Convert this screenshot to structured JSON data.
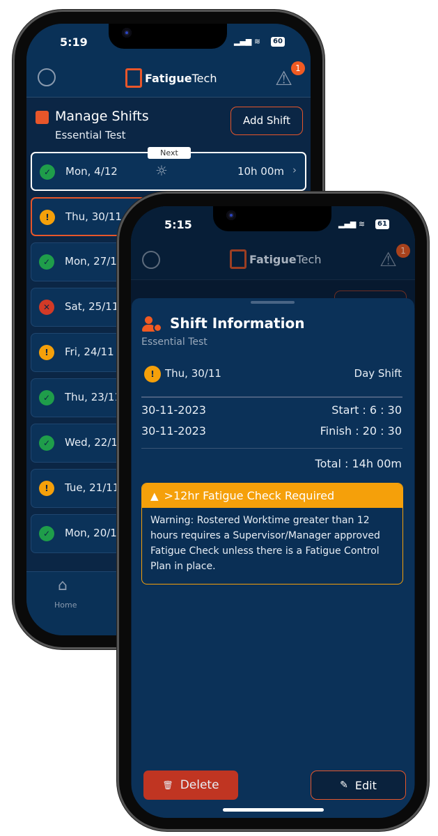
{
  "phone_back": {
    "status": {
      "time": "5:19",
      "battery": "60"
    },
    "header": {
      "logo": "FatigueTech",
      "logo_a": "Fatigue",
      "logo_b": "Tech",
      "alerts_badge": "1"
    },
    "section": {
      "title": "Manage Shifts",
      "subtitle": "Essential Test",
      "add_button": "Add Shift"
    },
    "next_label": "Next",
    "shifts": [
      {
        "date": "Mon, 4/12",
        "status": "ok",
        "duration": "10h 00m",
        "icon": "sun-icon"
      },
      {
        "date": "Thu, 30/11",
        "status": "warn"
      },
      {
        "date": "Mon, 27/11",
        "status": "ok"
      },
      {
        "date": "Sat, 25/11",
        "status": "bad"
      },
      {
        "date": "Fri, 24/11",
        "status": "warn"
      },
      {
        "date": "Thu, 23/11",
        "status": "ok"
      },
      {
        "date": "Wed, 22/11",
        "status": "ok"
      },
      {
        "date": "Tue, 21/11",
        "status": "warn"
      },
      {
        "date": "Mon, 20/11",
        "status": "ok"
      }
    ],
    "nav": {
      "home": "Home"
    }
  },
  "phone_front": {
    "status": {
      "time": "5:15",
      "battery": "61"
    },
    "header": {
      "logo_a": "Fatigue",
      "logo_b": "Tech",
      "alerts_badge": "1"
    },
    "sheet": {
      "title": "Shift Information",
      "subtitle": "Essential Test",
      "date": "Thu, 30/11",
      "shift_type": "Day Shift",
      "start_date": "30-11-2023",
      "start": "Start : 6 : 30",
      "finish_date": "30-11-2023",
      "finish": "Finish : 20 : 30",
      "total": "Total : 14h 00m",
      "warning_title": ">12hr Fatigue Check Required",
      "warning_body": "Warning: Rostered Worktime greater than 12 hours requires a Supervisor/Manager approved Fatigue Check unless there is a Fatigue Control Plan in place.",
      "delete": "Delete",
      "edit": "Edit"
    }
  },
  "colors": {
    "brand_orange": "#e8562a",
    "navy": "#0b3158",
    "ok": "#1f9d4a",
    "warn": "#f5a00a",
    "bad": "#d23a26",
    "delete": "#c03522"
  }
}
